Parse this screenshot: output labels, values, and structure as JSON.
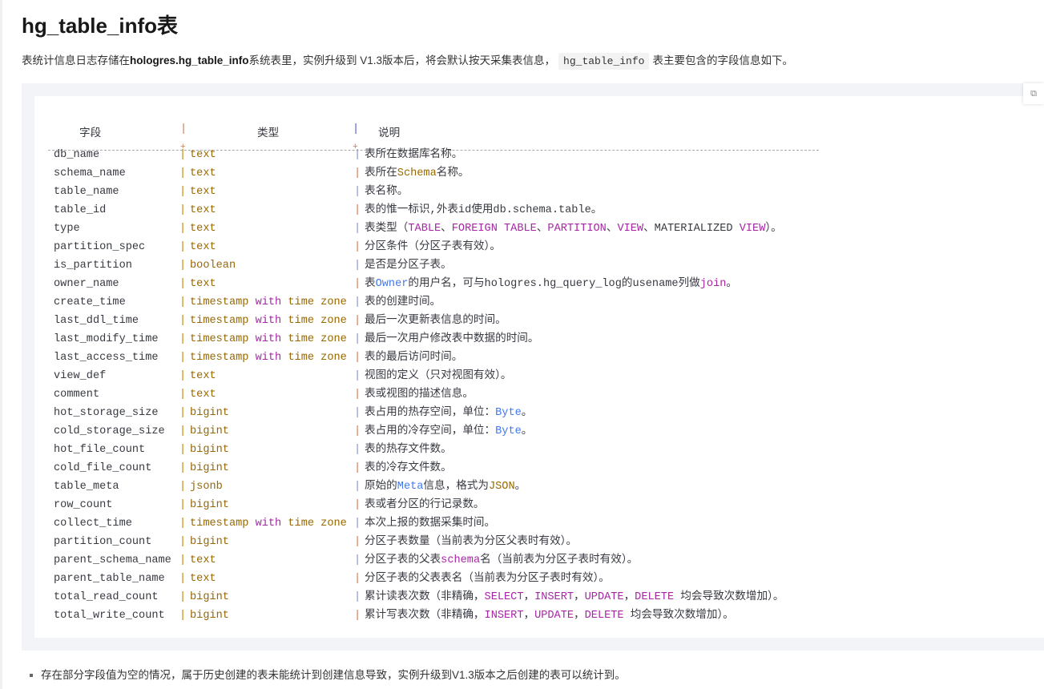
{
  "title": "hg_table_info表",
  "intro": {
    "p1": "表统计信息日志存储在",
    "bold": "hologres.hg_table_info",
    "p2": "系统表里，实例升级到 V1.3版本后，将会默认按天采集表信息，",
    "code": "hg_table_info",
    "p3": "表主要包含的字段信息如下。"
  },
  "table": {
    "headers": [
      "字段",
      "类型",
      "说明"
    ],
    "rows": [
      {
        "name": "db_name",
        "type": "text",
        "desc": [
          [
            "表所在数据库名称。",
            ""
          ]
        ]
      },
      {
        "name": "schema_name",
        "type": "text",
        "desc": [
          [
            "表所在",
            ""
          ],
          [
            "Schema",
            "ty"
          ],
          [
            "名称。",
            ""
          ]
        ]
      },
      {
        "name": "table_name",
        "type": "text",
        "desc": [
          [
            "表名称。",
            ""
          ]
        ]
      },
      {
        "name": "table_id",
        "type": "text",
        "desc": [
          [
            "表的惟一标识,外表id使用db.schema.table。",
            ""
          ]
        ]
      },
      {
        "name": "type",
        "type": "text",
        "desc": [
          [
            "表类型（",
            ""
          ],
          [
            "TABLE",
            "kw"
          ],
          [
            "、",
            ""
          ],
          [
            "FOREIGN TABLE",
            "kw"
          ],
          [
            "、",
            ""
          ],
          [
            "PARTITION",
            "kw"
          ],
          [
            "、",
            ""
          ],
          [
            "VIEW",
            "kw"
          ],
          [
            "、MATERIALIZED ",
            ""
          ],
          [
            "VIEW",
            "kw"
          ],
          [
            "）。",
            ""
          ]
        ]
      },
      {
        "name": "partition_spec",
        "type": "text",
        "desc": [
          [
            "分区条件（分区子表有效）。",
            ""
          ]
        ]
      },
      {
        "name": "is_partition",
        "type": "boolean",
        "desc": [
          [
            "是否是分区子表。",
            ""
          ]
        ]
      },
      {
        "name": "owner_name",
        "type": "text",
        "desc": [
          [
            "表",
            ""
          ],
          [
            "Owner",
            "nm"
          ],
          [
            "的用户名，可与hologres.hg_query_log的usename列做",
            ""
          ],
          [
            "join",
            "kw"
          ],
          [
            "。",
            ""
          ]
        ]
      },
      {
        "name": "create_time",
        "type": "timestamp with time zone",
        "desc": [
          [
            "表的创建时间。",
            ""
          ]
        ]
      },
      {
        "name": "last_ddl_time",
        "type": "timestamp with time zone",
        "desc": [
          [
            "最后一次更新表信息的时间。",
            ""
          ]
        ]
      },
      {
        "name": "last_modify_time",
        "type": "timestamp with time zone",
        "desc": [
          [
            "最后一次用户修改表中数据的时间。",
            ""
          ]
        ]
      },
      {
        "name": "last_access_time",
        "type": "timestamp with time zone",
        "desc": [
          [
            "表的最后访问时间。",
            ""
          ]
        ]
      },
      {
        "name": "view_def",
        "type": "text",
        "desc": [
          [
            "视图的定义（只对视图有效）。",
            ""
          ]
        ]
      },
      {
        "name": "comment",
        "type": "text",
        "desc": [
          [
            "表或视图的描述信息。",
            ""
          ]
        ]
      },
      {
        "name": "hot_storage_size",
        "type": "bigint",
        "desc": [
          [
            "表占用的热存空间，单位：",
            ""
          ],
          [
            "Byte",
            "nm"
          ],
          [
            "。",
            ""
          ]
        ]
      },
      {
        "name": "cold_storage_size",
        "type": "bigint",
        "desc": [
          [
            "表占用的冷存空间，单位：",
            ""
          ],
          [
            "Byte",
            "nm"
          ],
          [
            "。",
            ""
          ]
        ]
      },
      {
        "name": "hot_file_count",
        "type": "bigint",
        "desc": [
          [
            "表的热存文件数。",
            ""
          ]
        ]
      },
      {
        "name": "cold_file_count",
        "type": "bigint",
        "desc": [
          [
            "表的冷存文件数。",
            ""
          ]
        ]
      },
      {
        "name": "table_meta",
        "type": "jsonb",
        "desc": [
          [
            "原始的",
            ""
          ],
          [
            "Meta",
            "nm"
          ],
          [
            "信息，格式为",
            ""
          ],
          [
            "JSON",
            "ty"
          ],
          [
            "。",
            ""
          ]
        ]
      },
      {
        "name": "row_count",
        "type": "bigint",
        "desc": [
          [
            "表或者分区的行记录数。",
            ""
          ]
        ]
      },
      {
        "name": "collect_time",
        "type": "timestamp with time zone",
        "desc": [
          [
            "本次上报的数据采集时间。",
            ""
          ]
        ]
      },
      {
        "name": "partition_count",
        "type": "bigint",
        "desc": [
          [
            "分区子表数量（当前表为分区父表时有效）。",
            ""
          ]
        ]
      },
      {
        "name": "parent_schema_name",
        "type": "text",
        "desc": [
          [
            "分区子表的父表",
            ""
          ],
          [
            "schema",
            "kw"
          ],
          [
            "名（当前表为分区子表时有效）。",
            ""
          ]
        ]
      },
      {
        "name": "parent_table_name",
        "type": "text",
        "desc": [
          [
            "分区子表的父表表名（当前表为分区子表时有效）。",
            ""
          ]
        ]
      },
      {
        "name": "total_read_count",
        "type": "bigint",
        "desc": [
          [
            "累计读表次数（非精确，",
            ""
          ],
          [
            "SELECT",
            "kw"
          ],
          [
            "，",
            ""
          ],
          [
            "INSERT",
            "kw"
          ],
          [
            "，",
            ""
          ],
          [
            "UPDATE",
            "kw"
          ],
          [
            "，",
            ""
          ],
          [
            "DELETE",
            "kw"
          ],
          [
            " 均会导致次数增加）。",
            ""
          ]
        ]
      },
      {
        "name": "total_write_count",
        "type": "bigint",
        "desc": [
          [
            "累计写表次数（非精确，",
            ""
          ],
          [
            "INSERT",
            "kw"
          ],
          [
            "，",
            ""
          ],
          [
            "UPDATE",
            "kw"
          ],
          [
            "，",
            ""
          ],
          [
            "DELETE",
            "kw"
          ],
          [
            " 均会导致次数增加）。",
            ""
          ]
        ]
      }
    ]
  },
  "note": "存在部分字段值为空的情况，属于历史创建的表未能统计到创建信息导致，实例升级到V1.3版本之后创建的表可以统计到。",
  "side_button_icon": "copy-icon"
}
